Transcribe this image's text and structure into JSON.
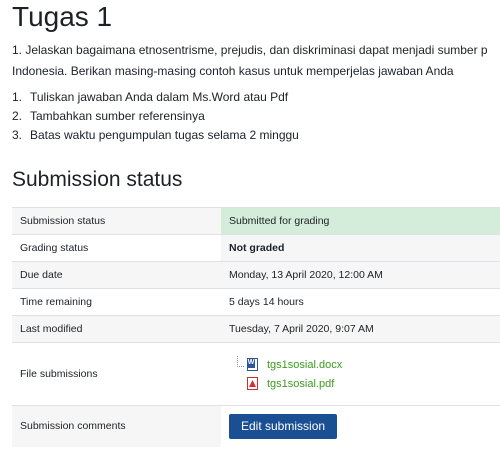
{
  "page": {
    "title": "Tugas 1",
    "intro_line1": "1. Jelaskan bagaimana etnosentrisme, prejudis, dan diskriminasi dapat menjadi sumber p",
    "intro_line2": "Indonesia. Berikan masing-masing contoh kasus untuk memperjelas jawaban Anda",
    "steps": [
      {
        "num": "1.",
        "text": "Tuliskan jawaban Anda dalam Ms.Word atau Pdf"
      },
      {
        "num": "2.",
        "text": "Tambahkan sumber referensinya"
      },
      {
        "num": "3.",
        "text": "Batas waktu pengumpulan tugas selama 2 minggu"
      }
    ]
  },
  "submission": {
    "heading": "Submission status",
    "rows": {
      "status": {
        "label": "Submission status",
        "value": "Submitted for grading",
        "color": "#d4edda"
      },
      "grading": {
        "label": "Grading status",
        "value": "Not graded"
      },
      "due": {
        "label": "Due date",
        "value": "Monday, 13 April 2020, 12:00 AM"
      },
      "remaining": {
        "label": "Time remaining",
        "value": "5 days 14 hours"
      },
      "modified": {
        "label": "Last modified",
        "value": "Tuesday, 7 April 2020, 9:07 AM"
      },
      "files": {
        "label": "File submissions",
        "items": [
          {
            "name": "tgs1sosial.docx",
            "icon": "word-document-icon"
          },
          {
            "name": "tgs1sosial.pdf",
            "icon": "pdf-document-icon"
          }
        ]
      },
      "comments": {
        "label": "Submission comments"
      }
    },
    "edit_button_label": "Edit submission",
    "accent_color": "#1b4f94",
    "link_color": "#3c9a1e"
  }
}
